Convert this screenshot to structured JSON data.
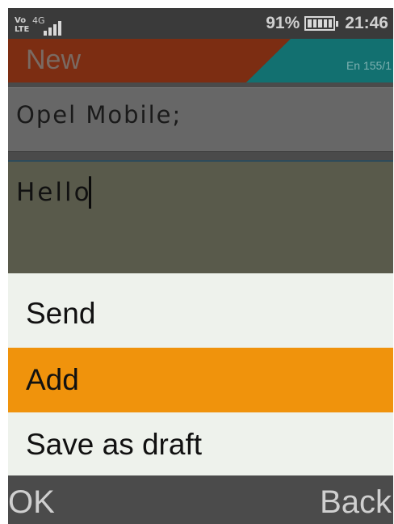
{
  "status_bar": {
    "volte_top": "Vo",
    "volte_bottom": "LTE",
    "network": "4G",
    "signal_bars": 4,
    "battery_percent": "91%",
    "battery_level": 1.0,
    "time": "21:46"
  },
  "title_bar": {
    "title": "New",
    "char_count": "En 155/1",
    "colors": {
      "left": "#7c2d12",
      "right": "#127070"
    }
  },
  "recipient": {
    "value": "Opel Mobile;"
  },
  "message": {
    "value": "Hello"
  },
  "options_menu": {
    "items": [
      {
        "label": "Send",
        "selected": false
      },
      {
        "label": "Add",
        "selected": true
      },
      {
        "label": "Save as draft",
        "selected": false
      }
    ],
    "highlight_color": "#f0930c"
  },
  "softkeys": {
    "left": "OK",
    "right": "Back"
  }
}
